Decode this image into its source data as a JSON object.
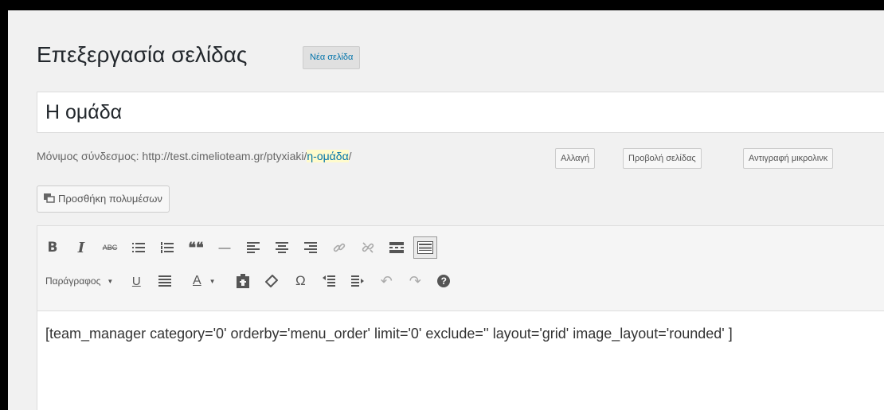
{
  "header": {
    "title": "Επεξεργασία σελίδας",
    "add_new_label": "Νέα σελίδα"
  },
  "post": {
    "title_value": "Η ομάδα"
  },
  "permalink": {
    "label": "Μόνιμος σύνδεσμος:",
    "base_url": "http://test.cimelioteam.gr/ptyxiaki/",
    "slug": "η-ομάδα",
    "trailing": "/",
    "edit_label": "Αλλαγή",
    "view_label": "Προβολή σελίδας",
    "shortlink_label": "Αντιγραφή μικρολινκ"
  },
  "media": {
    "button_label": "Προσθήκη πολυμέσων",
    "icon": "add-media-icon"
  },
  "toolbar": {
    "row1": [
      {
        "icon": "bold-icon",
        "glyph": "B"
      },
      {
        "icon": "italic-icon",
        "glyph": "I"
      },
      {
        "icon": "strikethrough-icon",
        "glyph": "ABC"
      },
      {
        "icon": "bullet-list-icon"
      },
      {
        "icon": "numbered-list-icon"
      },
      {
        "icon": "blockquote-icon",
        "glyph": "❝❝"
      },
      {
        "icon": "horizontal-line-icon",
        "glyph": "—"
      },
      {
        "icon": "align-left-icon"
      },
      {
        "icon": "align-center-icon"
      },
      {
        "icon": "align-right-icon"
      },
      {
        "icon": "insert-link-icon"
      },
      {
        "icon": "remove-link-icon"
      },
      {
        "icon": "read-more-icon"
      },
      {
        "icon": "toolbar-toggle-icon"
      }
    ],
    "format_value": "Παράγραφος",
    "row2": [
      {
        "icon": "underline-icon",
        "glyph": "U"
      },
      {
        "icon": "justify-icon"
      },
      {
        "icon": "text-color-icon",
        "glyph": "A"
      },
      {
        "icon": "paste-text-icon"
      },
      {
        "icon": "clear-formatting-icon"
      },
      {
        "icon": "special-character-icon",
        "glyph": "Ω"
      },
      {
        "icon": "outdent-icon"
      },
      {
        "icon": "indent-icon"
      },
      {
        "icon": "undo-icon",
        "glyph": "↶"
      },
      {
        "icon": "redo-icon",
        "glyph": "↷"
      },
      {
        "icon": "help-icon",
        "glyph": "?"
      }
    ]
  },
  "content": {
    "text": "[team_manager category='0' orderby='menu_order' limit='0' exclude='' layout='grid' image_layout='rounded' ]"
  },
  "colors": {
    "background": "#f1f1f1",
    "link": "#0073aa",
    "slug_highlight": "#fffbcc"
  }
}
